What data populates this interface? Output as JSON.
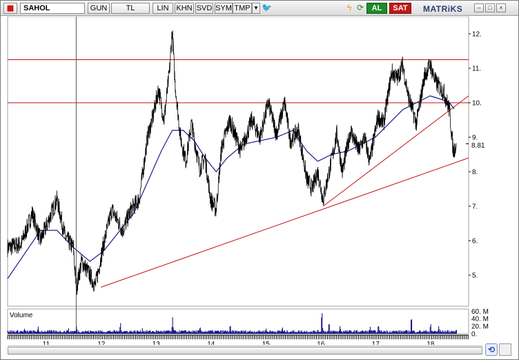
{
  "toolbar": {
    "symbol": "SAHOL",
    "buttons": [
      "GUN",
      "TL",
      "LIN",
      "KHN",
      "SVD",
      "SYM",
      "TMP"
    ],
    "buy_label": "AL",
    "sell_label": "SAT",
    "brand": "MATRiKS",
    "win_minimize": "–",
    "win_maximize": "□",
    "win_close": "×",
    "refresh_glyph": "⟲"
  },
  "colors": {
    "price": "#000000",
    "moving_average": "#1a1a8c",
    "trendline": "#c01010",
    "volume": "#1a1a8c",
    "brand": "#2b3d7a"
  },
  "chart_data": {
    "type": "line",
    "symbol": "SAHOL",
    "y_ticks": [
      "12.",
      "11.",
      "10.",
      "9.",
      "8.",
      "7.",
      "6.",
      "5."
    ],
    "y_tick_values": [
      12,
      11,
      10,
      9,
      8,
      7,
      6,
      5
    ],
    "ylim": [
      4.1,
      12.5
    ],
    "x_tick_labels": [
      "11",
      "12",
      "13",
      "14",
      "15",
      "16",
      "17",
      "18"
    ],
    "x_tick_positions": [
      10.7,
      11.7,
      12.7,
      13.7,
      14.7,
      15.7,
      16.7,
      17.7
    ],
    "xlim": [
      10.0,
      18.4
    ],
    "last_price_label": "8.81",
    "last_price": 8.81,
    "price_series_knots": [
      [
        10.0,
        5.8
      ],
      [
        10.25,
        5.9
      ],
      [
        10.45,
        6.8
      ],
      [
        10.6,
        6.0
      ],
      [
        10.75,
        6.6
      ],
      [
        10.9,
        7.2
      ],
      [
        11.05,
        6.1
      ],
      [
        11.2,
        5.8
      ],
      [
        11.25,
        4.6
      ],
      [
        11.35,
        5.4
      ],
      [
        11.5,
        5.0
      ],
      [
        11.6,
        4.7
      ],
      [
        11.75,
        5.9
      ],
      [
        11.9,
        6.9
      ],
      [
        12.1,
        6.3
      ],
      [
        12.25,
        6.9
      ],
      [
        12.4,
        7.2
      ],
      [
        12.55,
        9.0
      ],
      [
        12.65,
        9.6
      ],
      [
        12.75,
        10.4
      ],
      [
        12.85,
        9.5
      ],
      [
        12.95,
        10.9
      ],
      [
        13.0,
        12.1
      ],
      [
        13.05,
        10.6
      ],
      [
        13.15,
        9.0
      ],
      [
        13.25,
        8.3
      ],
      [
        13.35,
        9.4
      ],
      [
        13.5,
        8.1
      ],
      [
        13.6,
        8.4
      ],
      [
        13.7,
        7.2
      ],
      [
        13.8,
        6.9
      ],
      [
        13.9,
        8.7
      ],
      [
        14.05,
        9.5
      ],
      [
        14.25,
        8.6
      ],
      [
        14.45,
        9.5
      ],
      [
        14.6,
        9.0
      ],
      [
        14.75,
        10.0
      ],
      [
        14.9,
        9.1
      ],
      [
        15.05,
        10.0
      ],
      [
        15.15,
        8.9
      ],
      [
        15.3,
        9.2
      ],
      [
        15.45,
        7.8
      ],
      [
        15.55,
        7.5
      ],
      [
        15.65,
        8.0
      ],
      [
        15.75,
        7.2
      ],
      [
        15.9,
        8.3
      ],
      [
        16.0,
        9.1
      ],
      [
        16.1,
        8.0
      ],
      [
        16.25,
        9.2
      ],
      [
        16.4,
        8.6
      ],
      [
        16.5,
        9.0
      ],
      [
        16.6,
        8.3
      ],
      [
        16.75,
        9.6
      ],
      [
        16.85,
        9.4
      ],
      [
        17.0,
        10.9
      ],
      [
        17.1,
        10.7
      ],
      [
        17.2,
        11.1
      ],
      [
        17.3,
        10.2
      ],
      [
        17.45,
        9.4
      ],
      [
        17.6,
        10.8
      ],
      [
        17.7,
        11.1
      ],
      [
        17.8,
        10.6
      ],
      [
        17.95,
        10.3
      ],
      [
        18.05,
        9.8
      ],
      [
        18.12,
        8.6
      ],
      [
        18.18,
        8.81
      ]
    ],
    "moving_average_knots": [
      [
        10.0,
        4.9
      ],
      [
        10.3,
        5.6
      ],
      [
        10.6,
        6.3
      ],
      [
        10.9,
        6.3
      ],
      [
        11.2,
        5.8
      ],
      [
        11.5,
        5.4
      ],
      [
        11.75,
        5.7
      ],
      [
        12.0,
        6.2
      ],
      [
        12.3,
        6.8
      ],
      [
        12.55,
        7.7
      ],
      [
        12.8,
        8.6
      ],
      [
        13.0,
        9.2
      ],
      [
        13.2,
        9.2
      ],
      [
        13.4,
        8.9
      ],
      [
        13.6,
        8.4
      ],
      [
        13.8,
        8.0
      ],
      [
        14.0,
        8.4
      ],
      [
        14.3,
        8.8
      ],
      [
        14.6,
        8.9
      ],
      [
        14.9,
        9.0
      ],
      [
        15.2,
        9.2
      ],
      [
        15.45,
        8.6
      ],
      [
        15.65,
        8.3
      ],
      [
        15.9,
        8.5
      ],
      [
        16.2,
        8.6
      ],
      [
        16.45,
        8.8
      ],
      [
        16.7,
        9.0
      ],
      [
        16.95,
        9.4
      ],
      [
        17.2,
        9.8
      ],
      [
        17.45,
        10.0
      ],
      [
        17.7,
        10.2
      ],
      [
        17.9,
        10.1
      ],
      [
        18.05,
        10.0
      ],
      [
        18.15,
        9.8
      ]
    ],
    "trendlines": [
      {
        "kind": "horizontal",
        "y": 11.25
      },
      {
        "kind": "horizontal",
        "y": 10.0
      },
      {
        "kind": "segment",
        "x1": 11.7,
        "y1": 4.65,
        "x2": 18.4,
        "y2": 8.4
      },
      {
        "kind": "segment",
        "x1": 15.75,
        "y1": 7.0,
        "x2": 18.4,
        "y2": 10.2
      }
    ],
    "cursor_x": 11.25,
    "volume": {
      "title": "Volume",
      "y_ticks": [
        "60. M",
        "40. M",
        "20. M",
        "0."
      ],
      "y_tick_values": [
        60,
        40,
        20,
        0
      ],
      "ylim": [
        0,
        66
      ],
      "unit": "M",
      "spike_knots": [
        [
          10.3,
          12
        ],
        [
          10.55,
          18
        ],
        [
          11.1,
          15
        ],
        [
          11.25,
          22
        ],
        [
          12.05,
          30
        ],
        [
          12.45,
          14
        ],
        [
          13.0,
          42
        ],
        [
          13.5,
          20
        ],
        [
          14.05,
          25
        ],
        [
          14.7,
          15
        ],
        [
          15.0,
          18
        ],
        [
          15.72,
          68
        ],
        [
          15.85,
          32
        ],
        [
          16.05,
          22
        ],
        [
          16.6,
          18
        ],
        [
          16.75,
          25
        ],
        [
          17.35,
          52
        ],
        [
          17.7,
          28
        ],
        [
          17.85,
          20
        ]
      ]
    }
  }
}
